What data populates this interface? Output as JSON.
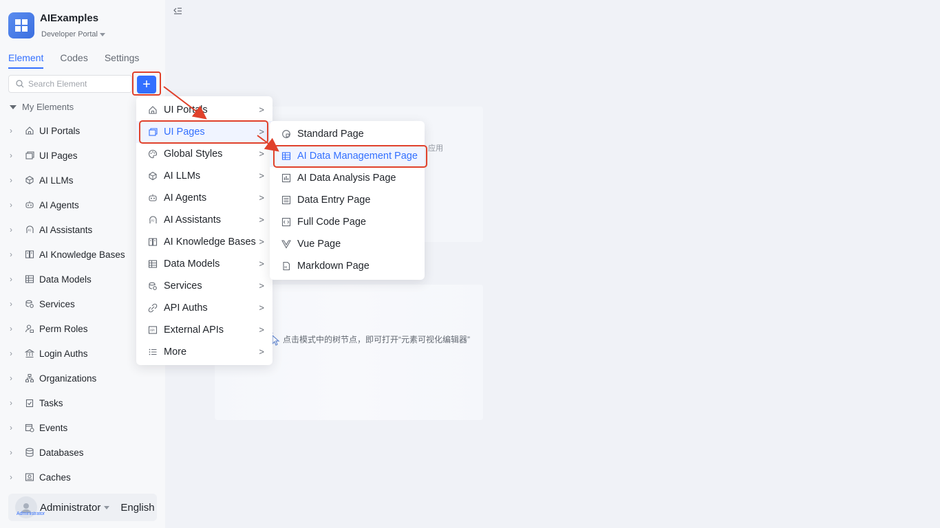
{
  "app": {
    "name": "AIExamples",
    "subtitle": "Developer Portal"
  },
  "tabs": [
    {
      "label": "Element",
      "active": true
    },
    {
      "label": "Codes",
      "active": false
    },
    {
      "label": "Settings",
      "active": false
    }
  ],
  "search": {
    "placeholder": "Search Element",
    "value": ""
  },
  "add_button": {
    "label": "+"
  },
  "tree": {
    "header": "My Elements",
    "items": [
      {
        "label": "UI Portals",
        "icon": "home-icon"
      },
      {
        "label": "UI Pages",
        "icon": "pages-icon"
      },
      {
        "label": "AI LLMs",
        "icon": "cube-icon"
      },
      {
        "label": "AI Agents",
        "icon": "robot-icon"
      },
      {
        "label": "AI Assistants",
        "icon": "ai-head-icon"
      },
      {
        "label": "AI Knowledge Bases",
        "icon": "book-icon"
      },
      {
        "label": "Data Models",
        "icon": "table-icon"
      },
      {
        "label": "Services",
        "icon": "services-icon"
      },
      {
        "label": "Perm Roles",
        "icon": "role-icon"
      },
      {
        "label": "Login Auths",
        "icon": "bank-icon"
      },
      {
        "label": "Organizations",
        "icon": "org-icon"
      },
      {
        "label": "Tasks",
        "icon": "task-icon"
      },
      {
        "label": "Events",
        "icon": "event-icon"
      },
      {
        "label": "Databases",
        "icon": "database-icon"
      },
      {
        "label": "Caches",
        "icon": "cache-icon"
      }
    ]
  },
  "user": {
    "name": "Administrator",
    "avatar_label": "Administrator",
    "language": "English"
  },
  "menu_primary": [
    {
      "label": "UI Portals",
      "icon": "home-icon",
      "highlighted": false
    },
    {
      "label": "UI Pages",
      "icon": "pages-icon",
      "highlighted": true
    },
    {
      "label": "Global Styles",
      "icon": "palette-icon",
      "highlighted": false
    },
    {
      "label": "AI LLMs",
      "icon": "cube-icon",
      "highlighted": false
    },
    {
      "label": "AI Agents",
      "icon": "robot-icon",
      "highlighted": false
    },
    {
      "label": "AI Assistants",
      "icon": "ai-head-icon",
      "highlighted": false
    },
    {
      "label": "AI Knowledge Bases",
      "icon": "book-icon",
      "highlighted": false
    },
    {
      "label": "Data Models",
      "icon": "table-icon",
      "highlighted": false
    },
    {
      "label": "Services",
      "icon": "services-icon",
      "highlighted": false
    },
    {
      "label": "API Auths",
      "icon": "link-icon",
      "highlighted": false
    },
    {
      "label": "External APIs",
      "icon": "api-icon",
      "highlighted": false
    },
    {
      "label": "More",
      "icon": "list-icon",
      "highlighted": false
    }
  ],
  "menu_secondary": [
    {
      "label": "Standard Page",
      "icon": "standard-page-icon",
      "highlighted": false
    },
    {
      "label": "AI Data Management Page",
      "icon": "table-icon",
      "highlighted": true
    },
    {
      "label": "AI Data Analysis Page",
      "icon": "bar-chart-icon",
      "highlighted": false
    },
    {
      "label": "Data Entry Page",
      "icon": "form-icon",
      "highlighted": false
    },
    {
      "label": "Full Code Page",
      "icon": "code-icon",
      "highlighted": false
    },
    {
      "label": "Vue Page",
      "icon": "vue-icon",
      "highlighted": false
    },
    {
      "label": "Markdown Page",
      "icon": "markdown-icon",
      "highlighted": false
    }
  ],
  "main": {
    "card1_text": "应用",
    "card2_text": "点击模式中的树节点，即可打开“元素可视化编辑器”"
  },
  "colors": {
    "accent": "#3370ff",
    "annotation": "#e0412b"
  }
}
